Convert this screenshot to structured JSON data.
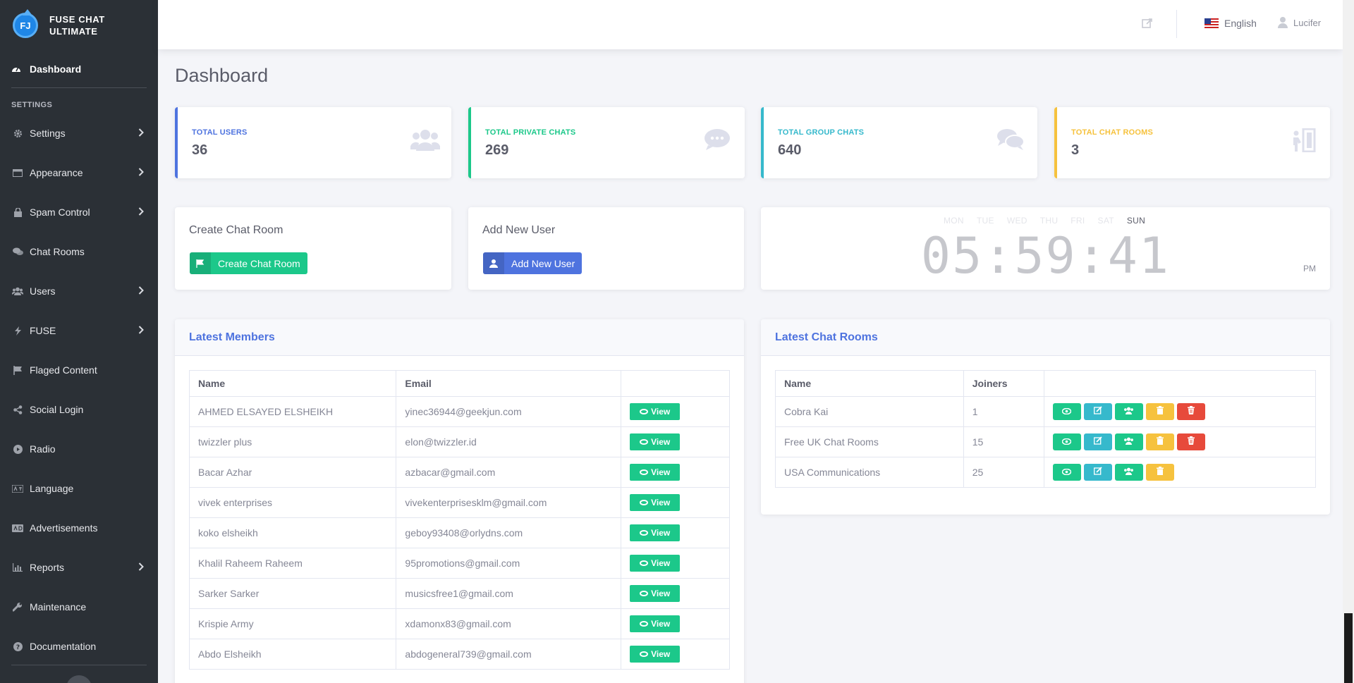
{
  "brand": {
    "line1": "FUSE CHAT",
    "line2": "ULTIMATE",
    "logo_text": "FJ"
  },
  "sidebar": {
    "dashboard_label": "Dashboard",
    "heading": "SETTINGS",
    "items": [
      {
        "label": "Settings",
        "icon": "gear-icon",
        "has_chevron": true
      },
      {
        "label": "Appearance",
        "icon": "window-icon",
        "has_chevron": true
      },
      {
        "label": "Spam Control",
        "icon": "lock-icon",
        "has_chevron": true
      },
      {
        "label": "Chat Rooms",
        "icon": "comments-icon",
        "has_chevron": false
      },
      {
        "label": "Users",
        "icon": "users-icon",
        "has_chevron": true
      },
      {
        "label": "FUSE",
        "icon": "bolt-icon",
        "has_chevron": true
      },
      {
        "label": "Flaged Content",
        "icon": "flag-icon",
        "has_chevron": false
      },
      {
        "label": "Social Login",
        "icon": "share-icon",
        "has_chevron": false
      },
      {
        "label": "Radio",
        "icon": "play-icon",
        "has_chevron": false
      },
      {
        "label": "Language",
        "icon": "language-icon",
        "has_chevron": false
      },
      {
        "label": "Advertisements",
        "icon": "ad-icon",
        "has_chevron": false
      },
      {
        "label": "Reports",
        "icon": "chart-icon",
        "has_chevron": true
      },
      {
        "label": "Maintenance",
        "icon": "wrench-icon",
        "has_chevron": false
      },
      {
        "label": "Documentation",
        "icon": "question-icon",
        "has_chevron": false
      }
    ]
  },
  "topbar": {
    "language": "English",
    "user": "Lucifer"
  },
  "page": {
    "title": "Dashboard"
  },
  "stats": [
    {
      "label": "TOTAL USERS",
      "value": "36",
      "color": "#4e73df",
      "icon": "users-icon"
    },
    {
      "label": "TOTAL PRIVATE CHATS",
      "value": "269",
      "color": "#1cc88a",
      "icon": "comment-icon"
    },
    {
      "label": "TOTAL GROUP CHATS",
      "value": "640",
      "color": "#36b9cc",
      "icon": "comments-icon"
    },
    {
      "label": "TOTAL CHAT ROOMS",
      "value": "3",
      "color": "#f6c23e",
      "icon": "door-icon"
    }
  ],
  "actions": {
    "create_room": {
      "title": "Create Chat Room",
      "button": "Create Chat Room"
    },
    "add_user": {
      "title": "Add New User",
      "button": "Add New User"
    }
  },
  "clock": {
    "days": [
      "MON",
      "TUE",
      "WED",
      "THU",
      "FRI",
      "SAT",
      "SUN"
    ],
    "active_day": "SUN",
    "time": "05:59:41",
    "ampm": "PM"
  },
  "latest_members": {
    "title": "Latest Members",
    "columns": [
      "Name",
      "Email",
      ""
    ],
    "view_label": "View",
    "rows": [
      {
        "name": "AHMED ELSAYED ELSHEIKH",
        "email": "yinec36944@geekjun.com"
      },
      {
        "name": "twizzler plus",
        "email": "elon@twizzler.id"
      },
      {
        "name": "Bacar Azhar",
        "email": "azbacar@gmail.com"
      },
      {
        "name": "vivek enterprises",
        "email": "vivekenterprisesklm@gmail.com"
      },
      {
        "name": "koko elsheikh",
        "email": "geboy93408@orlydns.com"
      },
      {
        "name": "Khalil Raheem Raheem",
        "email": "95promotions@gmail.com"
      },
      {
        "name": "Sarker Sarker",
        "email": "musicsfree1@gmail.com"
      },
      {
        "name": "Krispie Army",
        "email": "xdamonx83@gmail.com"
      },
      {
        "name": "Abdo Elsheikh",
        "email": "abdogeneral739@gmail.com"
      }
    ]
  },
  "latest_rooms": {
    "title": "Latest Chat Rooms",
    "columns": [
      "Name",
      "Joiners",
      ""
    ],
    "rows": [
      {
        "name": "Cobra Kai",
        "joiners": "1",
        "deletable": true
      },
      {
        "name": "Free UK Chat Rooms",
        "joiners": "15",
        "deletable": true
      },
      {
        "name": "USA Communications",
        "joiners": "25",
        "deletable": false
      }
    ]
  }
}
